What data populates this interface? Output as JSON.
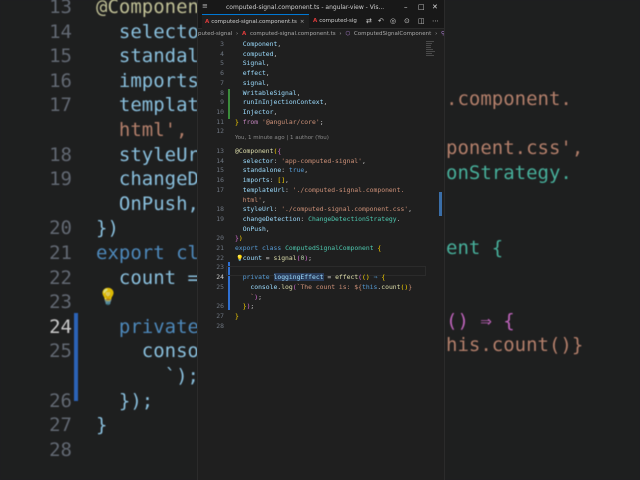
{
  "background": {
    "lines": [
      {
        "n": "13",
        "code": "@Component({"
      },
      {
        "n": "14",
        "code": "  selector"
      },
      {
        "n": "15",
        "code": "  standalo"
      },
      {
        "n": "16",
        "code": "  imports:"
      },
      {
        "n": "17",
        "code": "  template"
      },
      {
        "n": "",
        "code": "  html',"
      },
      {
        "n": "18",
        "code": "  styleUrl"
      },
      {
        "n": "19",
        "code": "  changeDet"
      },
      {
        "n": "",
        "code": "  OnPush,"
      },
      {
        "n": "20",
        "code": "})"
      },
      {
        "n": "21",
        "code": "export cla"
      },
      {
        "n": "22",
        "code": "  count ="
      },
      {
        "n": "23",
        "code": ""
      },
      {
        "n": "24",
        "code": "  private"
      },
      {
        "n": "25",
        "code": "    consol"
      },
      {
        "n": "",
        "code": "      `);"
      },
      {
        "n": "26",
        "code": "  });"
      },
      {
        "n": "27",
        "code": "}"
      },
      {
        "n": "28",
        "code": ""
      }
    ],
    "right_fragments": [
      ".component.",
      "ponent.css',",
      "onStrategy.",
      "ent {",
      "() ⇒ {",
      "his.count()}"
    ]
  },
  "window": {
    "title": "computed-signal.component.ts - angular-view - Vis...",
    "tabs": [
      {
        "label": "computed-signal.component.ts",
        "active": true
      },
      {
        "label": "computed-sig",
        "active": false
      }
    ],
    "breadcrumb": [
      "puted-signal",
      "computed-signal.component.ts",
      "ComputedSignalComponent",
      "logging"
    ]
  },
  "blame": "You, 1 minute ago | 1 author (You)",
  "editor": {
    "lines": [
      {
        "n": "3",
        "html": "  <span class=\"v\">Component</span>,"
      },
      {
        "n": "4",
        "html": "  <span class=\"v\">computed</span>,"
      },
      {
        "n": "5",
        "html": "  <span class=\"v\">Signal</span>,"
      },
      {
        "n": "6",
        "html": "  <span class=\"v\">effect</span>,"
      },
      {
        "n": "7",
        "html": "  <span class=\"v\">signal</span>,"
      },
      {
        "n": "8",
        "html": "  <span class=\"v\">WritableSignal</span>,"
      },
      {
        "n": "9",
        "html": "  <span class=\"v\">runInInjectionContext</span>,"
      },
      {
        "n": "10",
        "html": "  <span class=\"v\">Injector</span>,"
      },
      {
        "n": "11",
        "html": "<span class=\"p\">}</span> <span class=\"kw\">from</span> <span class=\"s\">'@angular/core'</span>;"
      },
      {
        "n": "12",
        "html": ""
      },
      {
        "n": "13",
        "html": "<span class=\"dec\">@Component</span><span class=\"p\">(</span><span class=\"br\">{</span>"
      },
      {
        "n": "14",
        "html": "  <span class=\"v\">selector</span>: <span class=\"s\">'app-computed-signal'</span>,"
      },
      {
        "n": "15",
        "html": "  <span class=\"v\">standalone</span>: <span class=\"k\">true</span>,"
      },
      {
        "n": "16",
        "html": "  <span class=\"v\">imports</span>: <span class=\"p\">[]</span>,"
      },
      {
        "n": "17",
        "html": "  <span class=\"v\">templateUrl</span>: <span class=\"s\">'./computed-signal.component.</span>"
      },
      {
        "n": "",
        "html": "  <span class=\"s\">html'</span>,"
      },
      {
        "n": "18",
        "html": "  <span class=\"v\">styleUrl</span>: <span class=\"s\">'./computed-signal.component.css'</span>,"
      },
      {
        "n": "19",
        "html": "  <span class=\"v\">changeDetection</span>: <span class=\"t\">ChangeDetectionStrategy</span>."
      },
      {
        "n": "",
        "html": "  <span class=\"v\">OnPush</span>,"
      },
      {
        "n": "20",
        "html": "<span class=\"br\">}</span><span class=\"p\">)</span>"
      },
      {
        "n": "21",
        "html": "<span class=\"k\">export</span> <span class=\"k\">class</span> <span class=\"t\">ComputedSignalComponent</span> <span class=\"p\">{</span>"
      },
      {
        "n": "22",
        "html": "  <span class=\"v\">count</span> = <span class=\"f\">signal</span><span class=\"br\">(</span><span class=\"num\">0</span><span class=\"br\">)</span>;"
      },
      {
        "n": "23",
        "html": ""
      },
      {
        "n": "24",
        "html": "  <span class=\"k\">private</span> <span class=\"v hl\">loggingEffect</span> = <span class=\"f\">effect</span><span class=\"br\">(</span><span class=\"p\">()</span> <span class=\"k\">⇒</span> <span class=\"p\">{</span>"
      },
      {
        "n": "25",
        "html": "    <span class=\"v\">console</span>.<span class=\"f\">log</span><span class=\"br\">(</span><span class=\"s\">`The count is: ${</span><span class=\"k\">this</span>.<span class=\"f\">count</span><span class=\"p\">()</span><span class=\"s\">}</span>"
      },
      {
        "n": "",
        "html": "    <span class=\"s\">`</span><span class=\"br\">)</span>;"
      },
      {
        "n": "26",
        "html": "  <span class=\"p\">}</span><span class=\"br\">)</span>;"
      },
      {
        "n": "27",
        "html": "<span class=\"p\">}</span>"
      },
      {
        "n": "28",
        "html": ""
      }
    ]
  }
}
